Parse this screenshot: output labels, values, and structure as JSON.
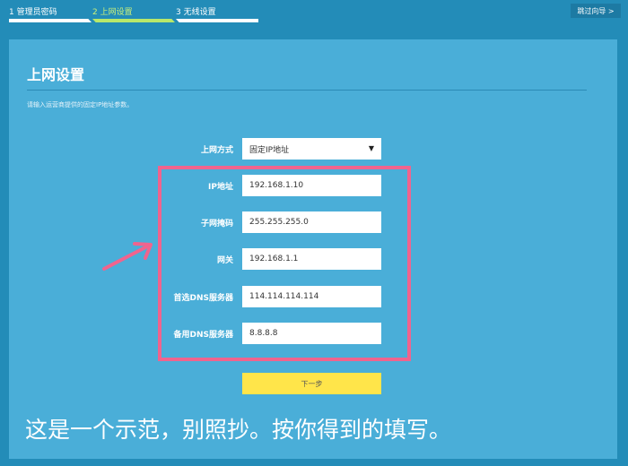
{
  "steps": [
    {
      "label": "1 管理员密码"
    },
    {
      "label": "2 上网设置"
    },
    {
      "label": "3 无线设置"
    }
  ],
  "skip_label": "跳过向导 >",
  "title": "上网设置",
  "description": "请输入运营商提供的固定IP地址参数。",
  "mode": {
    "label": "上网方式",
    "value": "固定IP地址"
  },
  "fields": [
    {
      "label": "IP地址",
      "value": "192.168.1.10"
    },
    {
      "label": "子网掩码",
      "value": "255.255.255.0"
    },
    {
      "label": "网关",
      "value": "192.168.1.1"
    },
    {
      "label": "首选DNS服务器",
      "value": "114.114.114.114"
    },
    {
      "label": "备用DNS服务器",
      "value": "8.8.8.8"
    }
  ],
  "next_label": "下一步",
  "caption": "这是一个示范，别照抄。按你得到的填写。",
  "colors": {
    "highlight": "#f0648e",
    "button": "#ffe54a",
    "active_step": "#b8e86a"
  }
}
